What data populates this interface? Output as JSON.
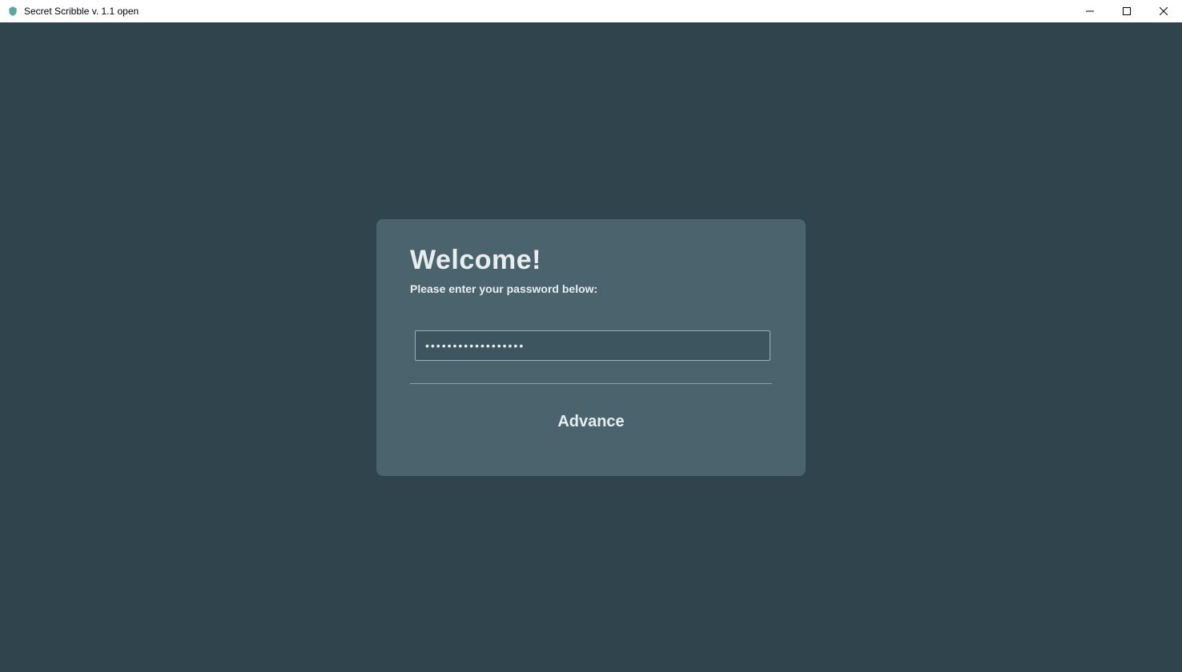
{
  "titlebar": {
    "title": "Secret Scribble v. 1.1 open"
  },
  "login": {
    "welcome": "Welcome!",
    "subtitle": "Please enter your password below:",
    "password_value": "******************",
    "advance_label": "Advance"
  },
  "colors": {
    "bg_dark": "#2f444d",
    "panel": "#4a636d",
    "input_bg": "#3c555f",
    "text_light": "#e8eef0"
  }
}
